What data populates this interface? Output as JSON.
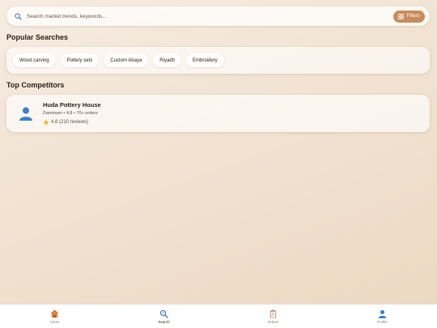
{
  "search": {
    "placeholder": "Search market trends, keywords...",
    "filters_label": "Filters"
  },
  "popular": {
    "title": "Popular Searches",
    "chips": [
      "Wood carving",
      "Pottery sets",
      "Custom Abaya",
      "Riyadh",
      "Embroidery"
    ]
  },
  "competitors": {
    "title": "Top Competitors",
    "items": [
      {
        "name": "Huda Pottery House",
        "meta": "Dammam • 4.8 • 70+ orders",
        "rating": "4.8 (210 reviews)"
      }
    ]
  },
  "nav": {
    "items": [
      {
        "label": "Home",
        "icon": "home-icon"
      },
      {
        "label": "Search",
        "icon": "search-icon"
      },
      {
        "label": "Orders",
        "icon": "clipboard-icon"
      },
      {
        "label": "Profile",
        "icon": "profile-icon"
      }
    ],
    "active": "Search"
  },
  "colors": {
    "accent": "#c98b5c",
    "background": "#f1e2d1",
    "star": "#f2b632"
  }
}
